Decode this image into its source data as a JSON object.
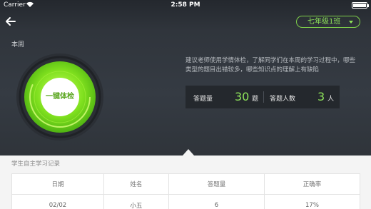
{
  "status_bar": {
    "carrier": "Carrier",
    "time": "2:58 PM"
  },
  "header": {
    "class_select": "七年级1班"
  },
  "summary": {
    "period_label": "本周",
    "check_button": "一键体检",
    "description": "建议老师使用学情体检，了解同学们在本周的学习过程中，哪些类型的题目出错较多，哪些知识点的理解上有缺陷",
    "answered_label": "答题量",
    "answered_value": "30",
    "answered_unit": "题",
    "people_label": "答题人数",
    "people_value": "3",
    "people_unit": "人"
  },
  "records": {
    "title": "学生自主学习记录",
    "columns": [
      "日期",
      "姓名",
      "答题量",
      "正确率"
    ],
    "rows": [
      [
        "02/02",
        "小五",
        "6",
        "17%"
      ]
    ]
  },
  "colors": {
    "accent": "#8ee35a",
    "header_bg": "#30353c"
  }
}
